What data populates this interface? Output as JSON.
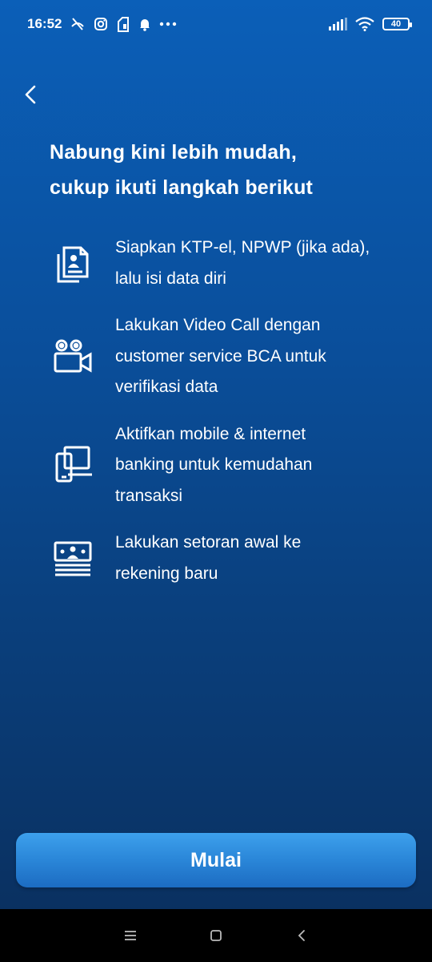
{
  "status_bar": {
    "time": "16:52",
    "battery": "40",
    "icons": [
      "missed-call-icon",
      "instagram-icon",
      "sim-icon",
      "notification-bell-icon",
      "more-dots-icon",
      "signal-icon",
      "wifi-icon",
      "battery-icon"
    ]
  },
  "header": {
    "back_icon": "chevron-left-icon",
    "title_line1": "Nabung kini lebih mudah,",
    "title_line2": "cukup ikuti langkah berikut"
  },
  "steps": [
    {
      "icon": "document-id-icon",
      "lines": [
        "Siapkan KTP-el, NPWP (jika ada),",
        "lalu isi data diri"
      ]
    },
    {
      "icon": "video-camera-icon",
      "lines": [
        "Lakukan Video Call dengan",
        "customer service BCA untuk",
        "verifikasi data"
      ]
    },
    {
      "icon": "devices-icon",
      "lines": [
        "Aktifkan mobile & internet",
        "banking untuk kemudahan",
        "transaksi"
      ]
    },
    {
      "icon": "money-stack-icon",
      "lines": [
        "Lakukan setoran awal ke",
        "rekening baru"
      ]
    }
  ],
  "cta": {
    "label": "Mulai"
  },
  "nav": {
    "icons": [
      "menu-icon",
      "home-icon",
      "back-icon"
    ]
  },
  "colors": {
    "background_top": "#0b5fb8",
    "background_bottom": "#0a2e5c",
    "button": "#2a86d8"
  }
}
